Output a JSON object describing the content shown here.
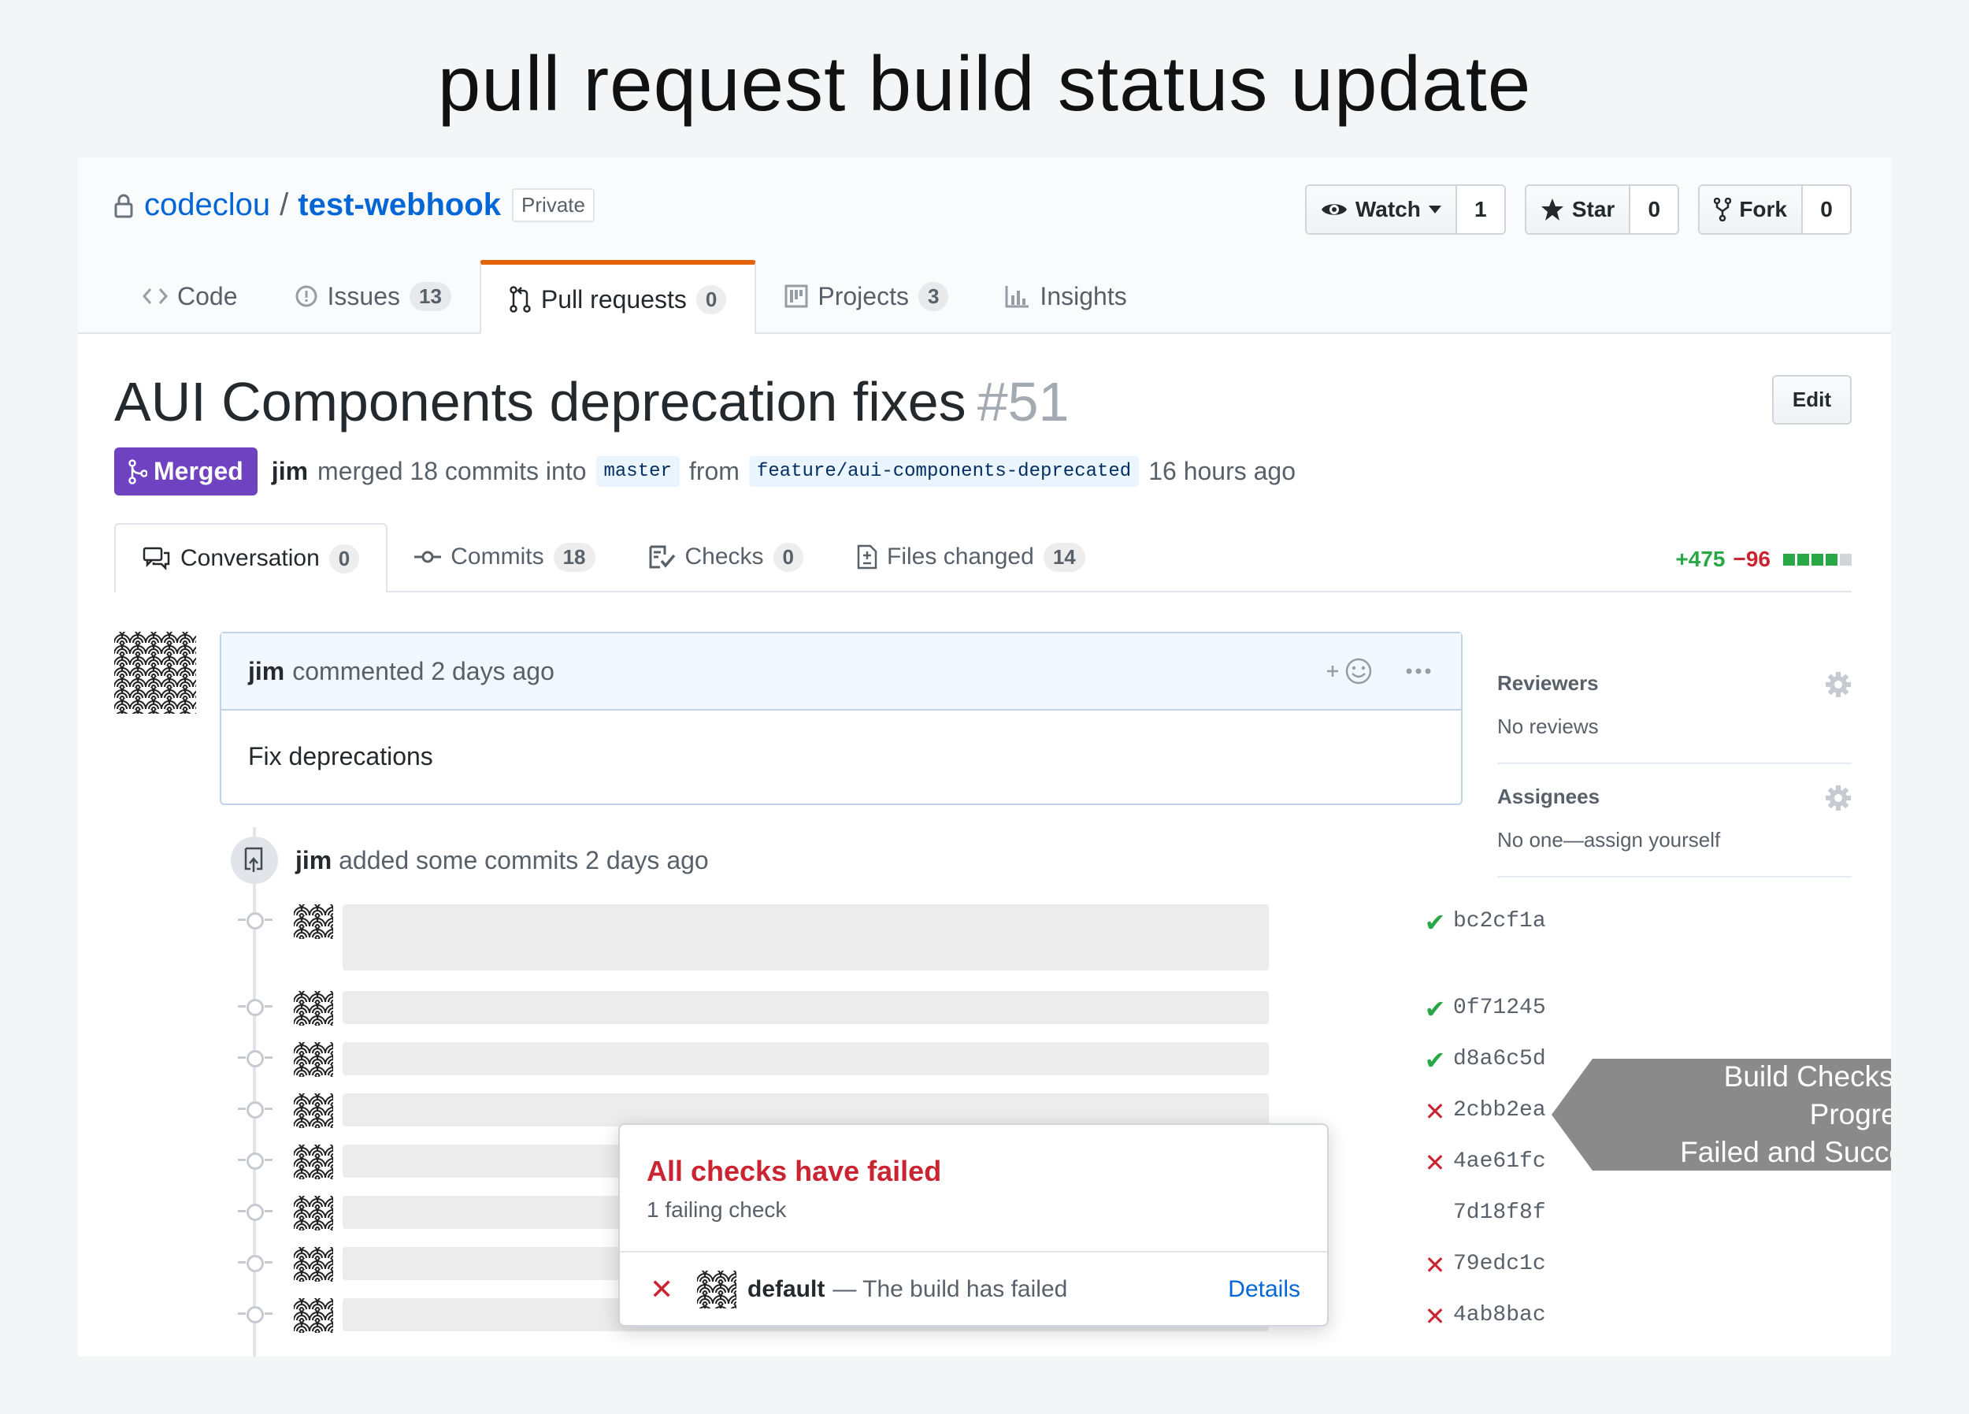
{
  "page_title": "pull request build status update",
  "repo": {
    "owner": "codeclou",
    "separator": "/",
    "name": "test-webhook",
    "visibility": "Private"
  },
  "actions": {
    "watch": {
      "label": "Watch",
      "count": "1"
    },
    "star": {
      "label": "Star",
      "count": "0"
    },
    "fork": {
      "label": "Fork",
      "count": "0"
    }
  },
  "reponav": [
    {
      "label": "Code",
      "icon": "code-icon"
    },
    {
      "label": "Issues",
      "count": "13",
      "icon": "issue-icon"
    },
    {
      "label": "Pull requests",
      "count": "0",
      "icon": "pull-request-icon"
    },
    {
      "label": "Projects",
      "count": "3",
      "icon": "project-icon"
    },
    {
      "label": "Insights",
      "icon": "graph-icon"
    }
  ],
  "pr": {
    "title": "AUI Components deprecation fixes",
    "number": "#51",
    "edit_label": "Edit",
    "state": "Merged",
    "author": "jim",
    "merge_text": "merged 18 commits into",
    "base_branch": "master",
    "from_text": "from",
    "head_branch": "feature/aui-components-deprecated",
    "time": "16 hours ago"
  },
  "pr_tabs": [
    {
      "label": "Conversation",
      "count": "0",
      "icon": "comment-discussion-icon"
    },
    {
      "label": "Commits",
      "count": "18",
      "icon": "commit-icon"
    },
    {
      "label": "Checks",
      "count": "0",
      "icon": "checklist-icon"
    },
    {
      "label": "Files changed",
      "count": "14",
      "icon": "file-diff-icon"
    }
  ],
  "diffstat": {
    "additions": "+475",
    "deletions": "−96",
    "colors": [
      "#28a745",
      "#28a745",
      "#28a745",
      "#28a745",
      "#d1d5da"
    ]
  },
  "comment": {
    "author": "jim",
    "action": "commented 2 days ago",
    "body": "Fix deprecations"
  },
  "event": {
    "author": "jim",
    "text": "added some commits 2 days ago"
  },
  "commits": [
    {
      "sha": "bc2cf1a",
      "status": "success"
    },
    {
      "sha": "0f71245",
      "status": "success"
    },
    {
      "sha": "d8a6c5d",
      "status": "success"
    },
    {
      "sha": "2cbb2ea",
      "status": "failure"
    },
    {
      "sha": "4ae61fc",
      "status": "failure"
    },
    {
      "sha": "7d18f8f",
      "status": "pending"
    },
    {
      "sha": "79edc1c",
      "status": "failure"
    },
    {
      "sha": "4ab8bac",
      "status": "failure"
    }
  ],
  "sidebar": {
    "reviewers": {
      "heading": "Reviewers",
      "value": "No reviews"
    },
    "assignees": {
      "heading": "Assignees",
      "value": "No one—assign yourself"
    }
  },
  "popover": {
    "title": "All checks have failed",
    "subtitle": "1 failing check",
    "check_name": "default",
    "check_desc": "— The build has failed",
    "details_label": "Details"
  },
  "callout": {
    "line1": "Build Checks: In Progress,",
    "line2": "Failed and Success"
  },
  "colors": {
    "link": "#0366d6",
    "merged": "#6f42c1",
    "success": "#28a745",
    "failure": "#cb2431",
    "tab_accent": "#e36209"
  }
}
